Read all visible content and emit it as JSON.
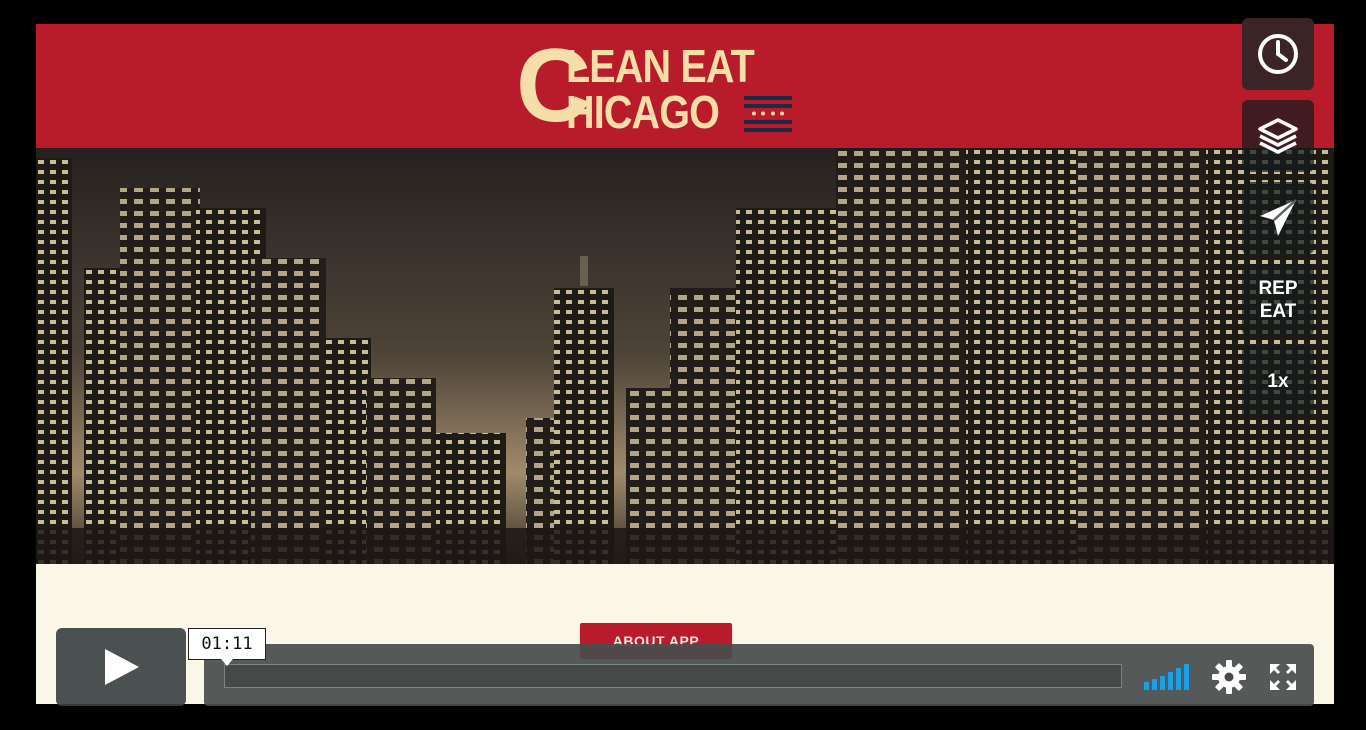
{
  "header": {
    "logo_text_c": "C",
    "logo_text_line1": "LEAN EAT",
    "logo_text_line2": "HICAGO",
    "background_color": "#b81c2b",
    "logo_color": "#f5deA8"
  },
  "hero": {
    "image": "chicago-skyline-night-sepia"
  },
  "content": {
    "about_button_label": "ABOUT APP"
  },
  "side_controls": [
    {
      "name": "watch-later",
      "icon": "clock-icon"
    },
    {
      "name": "collections",
      "icon": "layers-icon"
    },
    {
      "name": "share",
      "icon": "paper-plane-icon"
    },
    {
      "name": "repeat",
      "label_line1": "REP",
      "label_line2": "EAT"
    },
    {
      "name": "speed",
      "label": "1x"
    }
  ],
  "player": {
    "play_icon": "play-icon",
    "time": "01:11",
    "progress": 0,
    "volume_icon": "volume-bars-icon",
    "settings_icon": "gear-icon",
    "fullscreen_icon": "fullscreen-icon",
    "accent_color": "#1aa0e8"
  }
}
